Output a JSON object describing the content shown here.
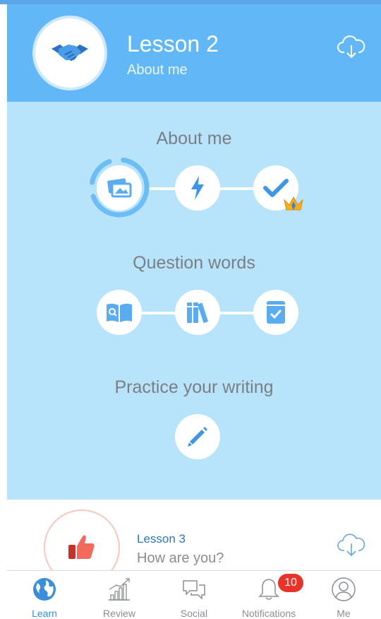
{
  "header": {
    "title": "Lesson 2",
    "subtitle": "About me",
    "avatar_icon": "handshake-icon",
    "download_icon": "cloud-download-icon"
  },
  "sections": [
    {
      "title": "About me",
      "nodes": [
        "photos-icon",
        "lightning-icon",
        "checkmark-icon"
      ],
      "badge_icon": "crown-icon"
    },
    {
      "title": "Question words",
      "nodes": [
        "book-search-icon",
        "books-icon",
        "notebook-check-icon"
      ]
    },
    {
      "title": "Practice your writing",
      "nodes": [
        "pencil-icon"
      ]
    }
  ],
  "next_lesson": {
    "title": "Lesson 3",
    "subtitle": "How are you?",
    "avatar_icon": "thumbs-up-icon",
    "download_icon": "cloud-download-icon"
  },
  "tabs": [
    {
      "label": "Learn",
      "icon": "globe-icon",
      "active": true
    },
    {
      "label": "Review",
      "icon": "chart-icon"
    },
    {
      "label": "Social",
      "icon": "chat-icon"
    },
    {
      "label": "Notifications",
      "icon": "bell-icon",
      "badge": "10"
    },
    {
      "label": "Me",
      "icon": "profile-icon"
    }
  ],
  "colors": {
    "header_bg": "#62b8f6",
    "body_bg": "#b7e3fb",
    "accent": "#3a8fd8",
    "badge": "#e8332b"
  }
}
